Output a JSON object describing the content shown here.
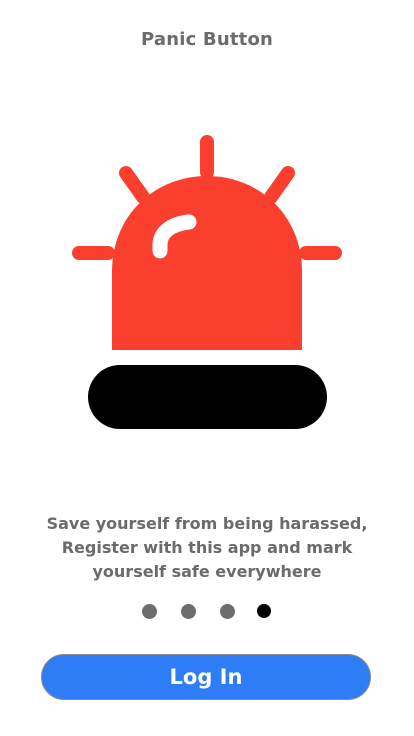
{
  "header": {
    "title": "Panic Button"
  },
  "illustration": {
    "icon": "alarm-siren-icon",
    "siren_color": "#fa3f2f",
    "base_color": "#000000",
    "highlight_color": "#ffffff"
  },
  "description": {
    "lines": [
      "Save yourself from being harassed,",
      "Register with this app and mark",
      "yourself safe everywhere"
    ]
  },
  "pager": {
    "total_pages": 4,
    "current_page": 4,
    "active_color": "#000000",
    "inactive_color": "#6d6d6d"
  },
  "login_button": {
    "label": "Log In",
    "color": "#2e7cf6"
  }
}
